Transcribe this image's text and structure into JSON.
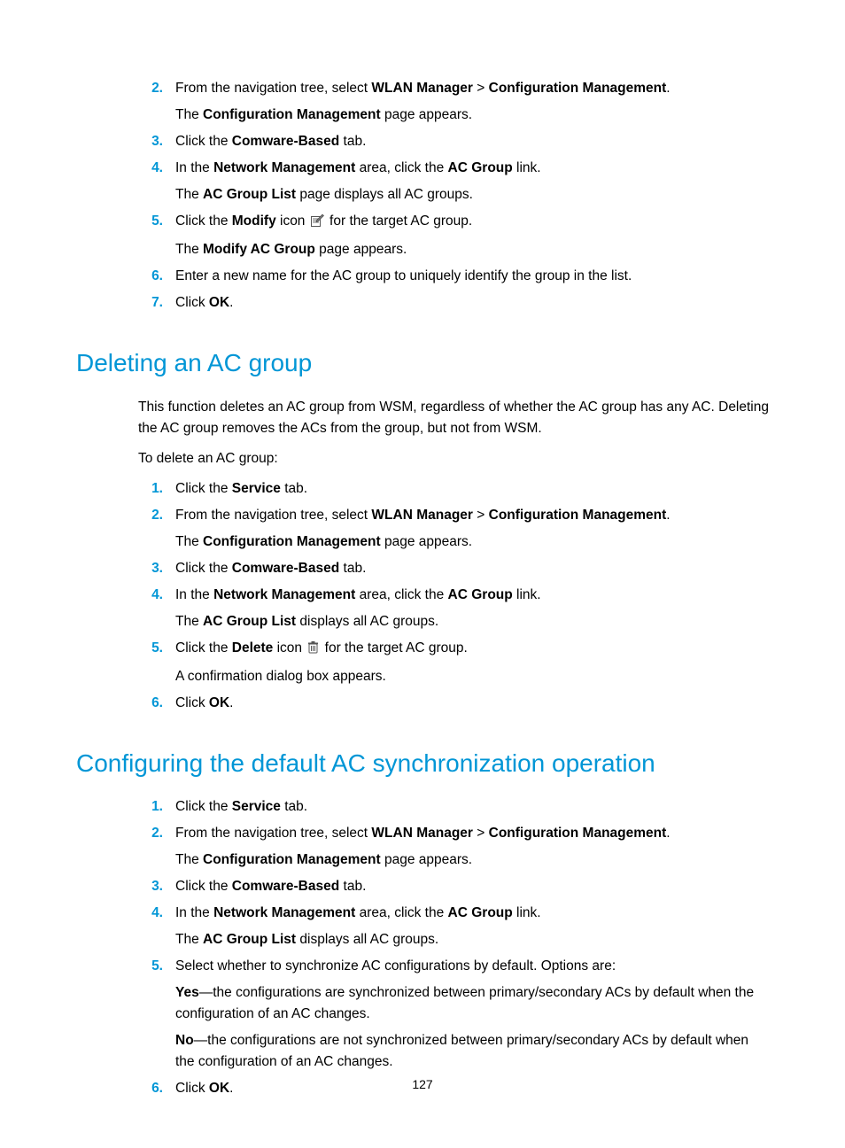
{
  "sectionA_steps": [
    {
      "num": "2.",
      "html_lines": [
        "From the navigation tree, select <strong>WLAN Manager</strong> &gt; <strong>Configuration Management</strong>.",
        "The <strong>Configuration Management</strong> page appears."
      ]
    },
    {
      "num": "3.",
      "html_lines": [
        "Click the <strong>Comware-Based</strong> tab."
      ]
    },
    {
      "num": "4.",
      "html_lines": [
        "In the <strong>Network Management</strong> area, click the <strong>AC Group</strong> link.",
        "The <strong>AC Group List</strong> page displays all AC groups."
      ]
    },
    {
      "num": "5.",
      "icon": "modify",
      "html_lines": [
        "Click the <strong>Modify</strong> icon {icon} for the target AC group.",
        "The <strong>Modify AC Group</strong> page appears."
      ]
    },
    {
      "num": "6.",
      "html_lines": [
        "Enter a new name for the AC group to uniquely identify the group in the list."
      ]
    },
    {
      "num": "7.",
      "html_lines": [
        "Click <strong>OK</strong>."
      ]
    }
  ],
  "sectionB_heading": "Deleting an AC group",
  "sectionB_intro_html": "This function deletes an AC group from WSM, regardless of whether the AC group has any AC. Deleting the AC group removes the ACs from the group, but not from WSM.",
  "sectionB_lead": "To delete an AC group:",
  "sectionB_steps": [
    {
      "num": "1.",
      "html_lines": [
        "Click the <strong>Service</strong> tab."
      ]
    },
    {
      "num": "2.",
      "html_lines": [
        "From the navigation tree, select <strong>WLAN Manager</strong> &gt; <strong>Configuration Management</strong>.",
        "The <strong>Configuration Management</strong> page appears."
      ]
    },
    {
      "num": "3.",
      "html_lines": [
        "Click the <strong>Comware-Based</strong> tab."
      ]
    },
    {
      "num": "4.",
      "html_lines": [
        "In the <strong>Network Management</strong> area, click the <strong>AC Group</strong> link.",
        "The <strong>AC Group List</strong> displays all AC groups."
      ]
    },
    {
      "num": "5.",
      "icon": "delete",
      "html_lines": [
        "Click the <strong>Delete</strong> icon {icon} for the target AC group.",
        "A confirmation dialog box appears."
      ]
    },
    {
      "num": "6.",
      "html_lines": [
        "Click <strong>OK</strong>."
      ]
    }
  ],
  "sectionC_heading": "Configuring the default AC synchronization operation",
  "sectionC_steps": [
    {
      "num": "1.",
      "html_lines": [
        "Click the <strong>Service</strong> tab."
      ]
    },
    {
      "num": "2.",
      "html_lines": [
        "From the navigation tree, select <strong>WLAN Manager</strong> &gt; <strong>Configuration Management</strong>.",
        "The <strong>Configuration Management</strong> page appears."
      ]
    },
    {
      "num": "3.",
      "html_lines": [
        "Click the <strong>Comware-Based</strong> tab."
      ]
    },
    {
      "num": "4.",
      "html_lines": [
        "In the <strong>Network Management</strong> area, click the <strong>AC Group</strong> link.",
        "The <strong>AC Group List</strong> displays all AC groups."
      ]
    },
    {
      "num": "5.",
      "html_lines": [
        "Select whether to synchronize AC configurations by default. Options are:",
        "<strong>Yes</strong>—the configurations are synchronized between primary/secondary ACs by default when the configuration of an AC changes.",
        "<strong>No</strong>—the configurations are not synchronized between primary/secondary ACs by default when the configuration of an AC changes."
      ]
    },
    {
      "num": "6.",
      "html_lines": [
        "Click <strong>OK</strong>."
      ]
    }
  ],
  "page_number": "127"
}
